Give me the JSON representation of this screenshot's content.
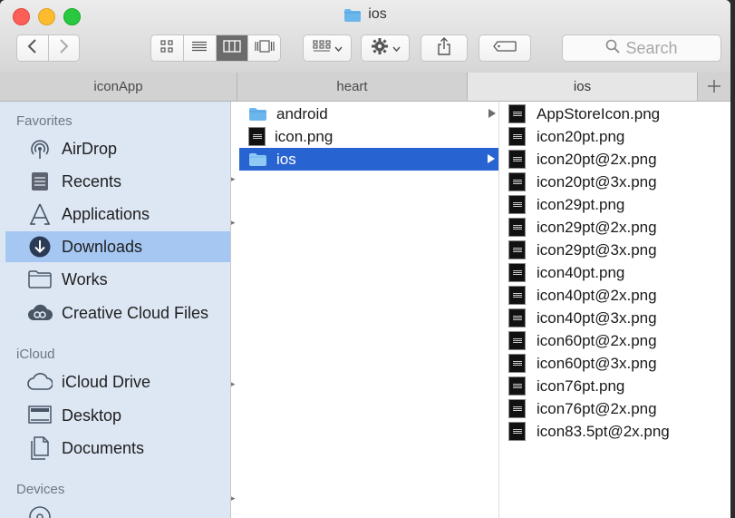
{
  "window": {
    "title": "ios"
  },
  "toolbar": {
    "back": "back",
    "forward": "forward",
    "view_modes": [
      "icon-view",
      "list-view",
      "column-view",
      "gallery-view"
    ],
    "active_view": "column-view",
    "search_placeholder": "Search"
  },
  "tabs": [
    {
      "label": "iconApp"
    },
    {
      "label": "heart"
    },
    {
      "label": "ios"
    }
  ],
  "sidebar": {
    "favorites_header": "Favorites",
    "favorites": [
      {
        "label": "AirDrop",
        "icon": "airdrop-icon"
      },
      {
        "label": "Recents",
        "icon": "recents-icon"
      },
      {
        "label": "Applications",
        "icon": "applications-icon"
      },
      {
        "label": "Downloads",
        "icon": "downloads-icon",
        "selected": true
      },
      {
        "label": "Works",
        "icon": "folder-icon"
      },
      {
        "label": "Creative Cloud Files",
        "icon": "creative-cloud-icon"
      }
    ],
    "icloud_header": "iCloud",
    "icloud": [
      {
        "label": "iCloud Drive",
        "icon": "cloud-icon"
      },
      {
        "label": "Desktop",
        "icon": "desktop-icon"
      },
      {
        "label": "Documents",
        "icon": "documents-icon"
      }
    ],
    "devices_header": "Devices"
  },
  "column1": [
    {
      "label": "android",
      "type": "folder"
    },
    {
      "label": "icon.png",
      "type": "image"
    },
    {
      "label": "ios",
      "type": "folder",
      "selected": true
    }
  ],
  "column2": [
    {
      "label": "AppStoreIcon.png"
    },
    {
      "label": "icon20pt.png"
    },
    {
      "label": "icon20pt@2x.png"
    },
    {
      "label": "icon20pt@3x.png"
    },
    {
      "label": "icon29pt.png"
    },
    {
      "label": "icon29pt@2x.png"
    },
    {
      "label": "icon29pt@3x.png"
    },
    {
      "label": "icon40pt.png"
    },
    {
      "label": "icon40pt@2x.png"
    },
    {
      "label": "icon40pt@3x.png"
    },
    {
      "label": "icon60pt@2x.png"
    },
    {
      "label": "icon60pt@3x.png"
    },
    {
      "label": "icon76pt.png"
    },
    {
      "label": "icon76pt@2x.png"
    },
    {
      "label": "icon83.5pt@2x.png"
    }
  ],
  "colors": {
    "selection": "#2864d1",
    "sidebar_bg": "#dde7f4",
    "sidebar_selection": "#a6c7f2",
    "folder": "#6cb6ee"
  }
}
